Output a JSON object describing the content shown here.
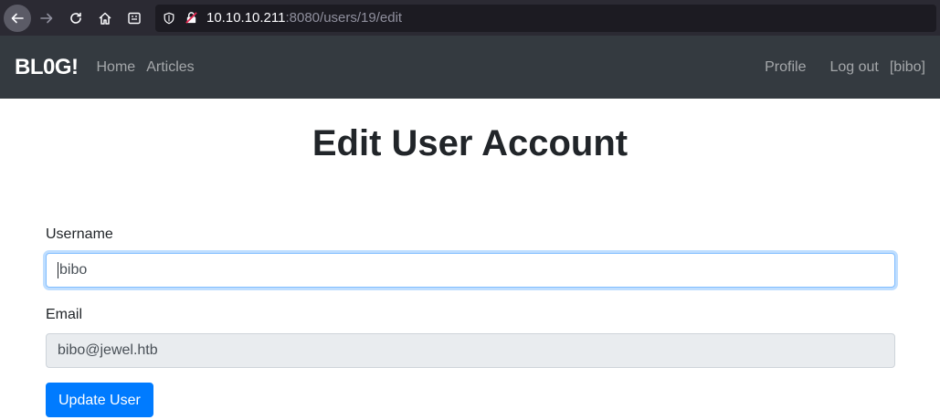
{
  "browser": {
    "url_host": "10.10.10.211",
    "url_rest": ":8080/users/19/edit"
  },
  "navbar": {
    "brand": "BL0G!",
    "links": [
      "Home",
      "Articles"
    ],
    "profile": "Profile",
    "logout": "Log out",
    "user": "[bibo]"
  },
  "page": {
    "title": "Edit User Account"
  },
  "form": {
    "username_label": "Username",
    "username_value": "bibo",
    "email_label": "Email",
    "email_value": "bibo@jewel.htb",
    "submit_label": "Update User"
  }
}
